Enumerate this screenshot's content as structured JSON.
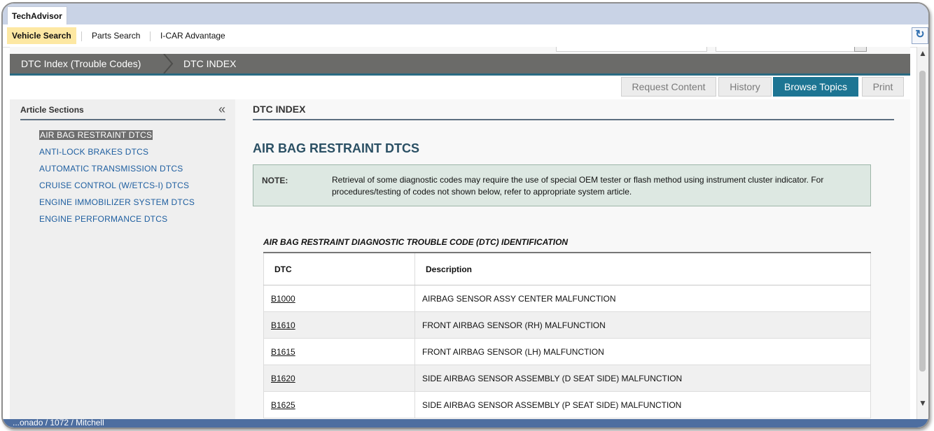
{
  "app": {
    "title": "TechAdvisor"
  },
  "nav": {
    "items": [
      {
        "label": "Vehicle Search",
        "active": true
      },
      {
        "label": "Parts Search",
        "active": false
      },
      {
        "label": "I-CAR Advantage",
        "active": false
      }
    ],
    "refresh_icon": "refresh-icon"
  },
  "breadcrumb": {
    "items": [
      {
        "label": "DTC Index (Trouble Codes)"
      },
      {
        "label": "DTC INDEX"
      }
    ]
  },
  "toolbar": {
    "request_content": "Request Content",
    "history": "History",
    "browse_topics": "Browse Topics",
    "print": "Print",
    "accent_color": "#1d7593"
  },
  "sidebar": {
    "title": "Article Sections",
    "collapse_glyph": "«",
    "items": [
      {
        "label": "AIR BAG RESTRAINT DTCS",
        "current": true
      },
      {
        "label": "ANTI-LOCK BRAKES DTCS"
      },
      {
        "label": "AUTOMATIC TRANSMISSION DTCS"
      },
      {
        "label": "CRUISE CONTROL (W/ETCS-I) DTCS"
      },
      {
        "label": "ENGINE IMMOBILIZER SYSTEM DTCS"
      },
      {
        "label": "ENGINE PERFORMANCE DTCS"
      }
    ]
  },
  "main": {
    "header": "DTC INDEX",
    "section_title": "AIR BAG RESTRAINT DTCS",
    "note": {
      "label": "NOTE:",
      "text": "Retrieval of some diagnostic codes may require the use of special OEM tester or flash method using instrument cluster indicator. For procedures/testing of codes not shown below, refer to appropriate system article."
    },
    "table": {
      "title": "AIR BAG RESTRAINT DIAGNOSTIC TROUBLE CODE (DTC) IDENTIFICATION",
      "headers": {
        "dtc": "DTC",
        "description": "Description"
      },
      "rows": [
        {
          "dtc": "B1000",
          "description": "AIRBAG SENSOR ASSY CENTER MALFUNCTION"
        },
        {
          "dtc": "B1610",
          "description": "FRONT AIRBAG SENSOR (RH) MALFUNCTION"
        },
        {
          "dtc": "B1615",
          "description": "FRONT AIRBAG SENSOR (LH) MALFUNCTION"
        },
        {
          "dtc": "B1620",
          "description": "SIDE AIRBAG SENSOR ASSEMBLY (D SEAT SIDE) MALFUNCTION"
        },
        {
          "dtc": "B1625",
          "description": "SIDE AIRBAG SENSOR ASSEMBLY (P SEAT SIDE) MALFUNCTION"
        }
      ]
    }
  },
  "status": {
    "text": "...onado / 1072 / Mitchell"
  }
}
